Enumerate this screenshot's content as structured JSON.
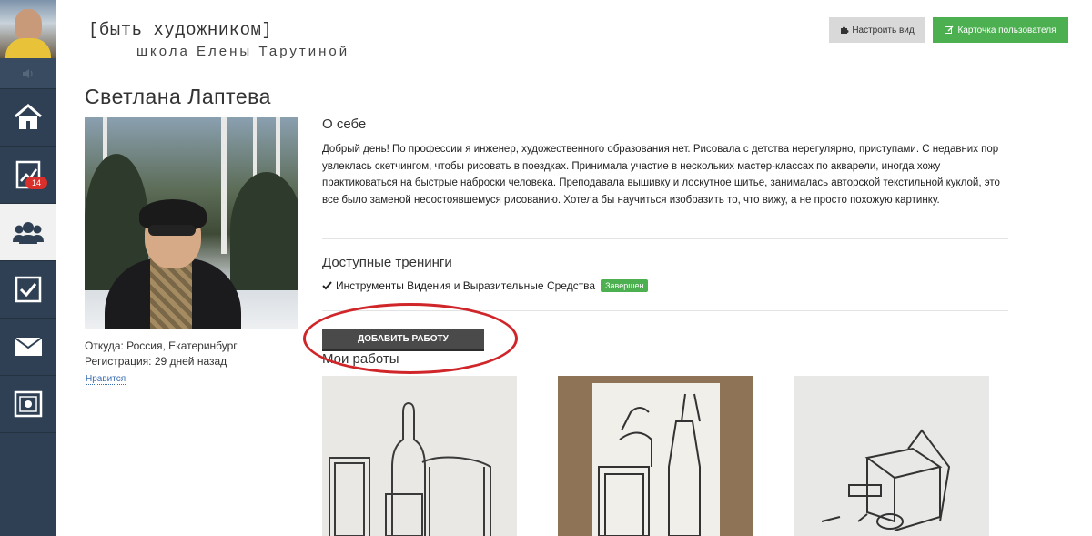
{
  "sidebar": {
    "badge_count": "14",
    "items": [
      {
        "icon": "home-icon"
      },
      {
        "icon": "progress-chart-icon"
      },
      {
        "icon": "users-icon"
      },
      {
        "icon": "checkbox-icon"
      },
      {
        "icon": "mail-icon"
      },
      {
        "icon": "settings-panel-icon"
      }
    ]
  },
  "header": {
    "logo_line1": "[быть художником]",
    "logo_line2": "школа Елены Тарутиной",
    "view_button": "Настроить вид",
    "card_button": "Карточка пользователя"
  },
  "profile": {
    "name": "Светлана Лаптева",
    "from": "Откуда: Россия, Екатеринбург",
    "registration": "Регистрация: 29 дней назад",
    "like": "Нравится"
  },
  "about": {
    "title": "О себе",
    "text": "Добрый день! По профессии я инженер, художественного образования нет. Рисовала с детства нерегулярно, приступами. С недавних пор увлеклась скетчингом, чтобы рисовать в поездках. Принимала участие в нескольких мастер-классах по акварели, иногда хожу практиковаться на быстрые наброски человека. Преподавала вышивку и лоскутное шитье, занималась авторской текстильной куклой, это все было заменой несостоявшемуся рисованию. Хотела бы научиться изобразить то, что вижу, а не просто похожую картинку."
  },
  "trainings": {
    "title": "Доступные тренинги",
    "items": [
      {
        "name": "Инструменты Видения и Выразительные Средства",
        "status": "Завершен"
      }
    ]
  },
  "works": {
    "add_button": "ДОБАВИТЬ РАБОТУ",
    "title": "Мои работы"
  },
  "colors": {
    "sidebar": "#2f4054",
    "accent_green": "#4caf50",
    "highlight_red": "#d0262a"
  }
}
